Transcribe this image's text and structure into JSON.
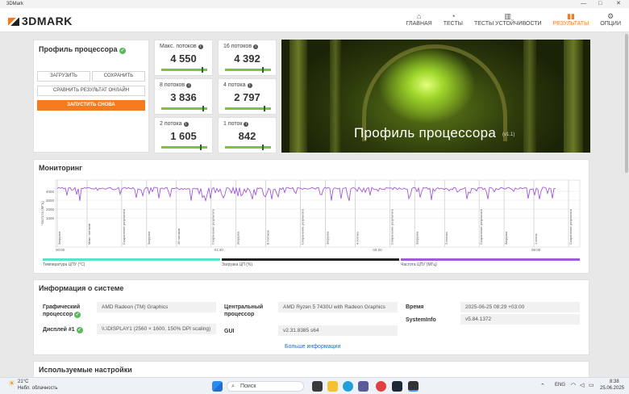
{
  "window": {
    "title": "3DMark",
    "controls": [
      "—",
      "□",
      "✕"
    ]
  },
  "header": {
    "logo": "3DMARK",
    "nav": [
      {
        "label": "ГЛАВНАЯ",
        "icon": "home-icon",
        "glyph": "⌂",
        "active": false
      },
      {
        "label": "ТЕСТЫ",
        "icon": "gauge-icon",
        "glyph": "◔",
        "active": false
      },
      {
        "label": "ТЕСТЫ УСТОЙЧИВОСТИ",
        "icon": "bars-icon",
        "glyph": "▥",
        "active": false
      },
      {
        "label": "РЕЗУЛЬТАТЫ",
        "icon": "results-icon",
        "glyph": "▮▮",
        "active": true
      },
      {
        "label": "ОПЦИИ",
        "icon": "gear-icon",
        "glyph": "⚙",
        "active": false
      }
    ]
  },
  "profile": {
    "title": "Профиль процессора",
    "load_label": "ЗАГРУЗИТЬ",
    "save_label": "СОХРАНИТЬ",
    "compare_label": "СРАВНИТЬ РЕЗУЛЬТАТ ОНЛАЙН",
    "run_again_label": "ЗАПУСТИТЬ СНОВА"
  },
  "scores": [
    {
      "label": "Макс. потоков",
      "value": "4 550",
      "marker": 0.88
    },
    {
      "label": "16 потоков",
      "value": "4 392",
      "marker": 0.8
    },
    {
      "label": "8 потоков",
      "value": "3 836",
      "marker": 0.9
    },
    {
      "label": "4 потока",
      "value": "2 797",
      "marker": 0.85
    },
    {
      "label": "2 потока",
      "value": "1 605",
      "marker": 0.85
    },
    {
      "label": "1 поток",
      "value": "842",
      "marker": 0.8
    }
  ],
  "hero": {
    "title": "Профиль процессора",
    "version": "(v1.1)"
  },
  "monitoring": {
    "title": "Мониторинг",
    "y_label": "Частота (МГц)",
    "y_ticks": [
      "4000",
      "3000",
      "2000",
      "1000"
    ],
    "x_ticks": [
      "00:00",
      "01:40",
      "03:20",
      "05:00"
    ],
    "markers": [
      "Загрузка",
      "Макс. потоков",
      "Сохранение результата",
      "Загрузка",
      "16 потоков",
      "Сохранение результата",
      "Загрузка",
      "8 потоков",
      "Сохранение результата",
      "Загрузка",
      "4 потока",
      "Сохранение результата",
      "Загрузка",
      "2 потока",
      "Сохранение результата",
      "Загрузка",
      "1 поток",
      "Сохранение результата"
    ],
    "legend": [
      {
        "label": "Температура ЦПУ (°C)",
        "color": "#5fe0c8"
      },
      {
        "label": "Загрузка ЦП (%)",
        "color": "#222222"
      },
      {
        "label": "Частота ЦПУ (МГц)",
        "color": "#a25ad8"
      }
    ]
  },
  "system_info": {
    "title": "Информация о системе",
    "gpu_label": "Графический процессор",
    "gpu_value": "AMD Radeon (TM) Graphics",
    "display_label": "Дисплей #1",
    "display_value": "\\\\.\\DISPLAY1 (2560 × 1600, 150% DPI scaling)",
    "cpu_label": "Центральный процессор",
    "cpu_value": "AMD Ryzen 5 7430U with Radeon Graphics",
    "gui_label": "GUI",
    "gui_value": "v2.31.8385 s64",
    "time_label": "Время",
    "time_value": "2025-06-25 08:29 +03:00",
    "sysinfo_label": "SystemInfo",
    "sysinfo_value": "v5.84.1372",
    "more_link": "Больше информации"
  },
  "settings": {
    "title": "Используемые настройки"
  },
  "taskbar": {
    "weather_temp": "21°C",
    "weather_text": "Небл. облачность",
    "search_placeholder": "Поиск",
    "lang": "ENG",
    "time": "8:38",
    "date": "25.06.2025"
  }
}
